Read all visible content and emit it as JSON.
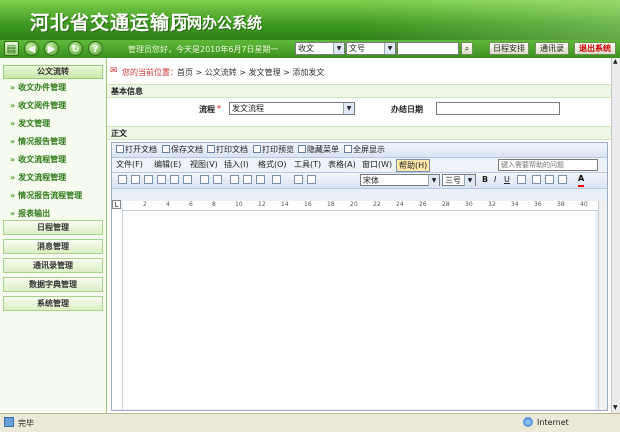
{
  "header": {
    "title": "河北省交通运输厅",
    "subtitle": "内网办公系统"
  },
  "toolbar": {
    "greeting": "管理员您好，今天是2010年6月7日星期一",
    "doc_type_select": "收文",
    "doc_num_select": "文号",
    "search_value": "",
    "btn_schedule": "日程安排",
    "btn_contacts": "通讯录",
    "btn_logout": "退出系统"
  },
  "sidebar": {
    "header": "公文流转",
    "items": [
      "收文办件管理",
      "收文阅件管理",
      "发文管理",
      "情况报告管理",
      "收文流程管理",
      "发文流程管理",
      "情况报告流程管理",
      "报表输出"
    ],
    "sections": [
      "日程管理",
      "消息管理",
      "通讯录管理",
      "数据字典管理",
      "系统管理"
    ]
  },
  "breadcrumb": {
    "prefix": "您的当前位置：",
    "path": "首页 > 公文流转 > 发文管理 > 添加发文"
  },
  "basic_info": {
    "title": "基本信息",
    "flow_label": "流程",
    "required_mark": "*",
    "flow_value": "发文流程",
    "date_label": "办结日期",
    "date_value": ""
  },
  "body_section": {
    "title": "正文"
  },
  "editor": {
    "actions": [
      "打开文档",
      "保存文档",
      "打印文档",
      "打印预览",
      "隐藏菜单",
      "全屏显示"
    ],
    "menus": [
      "文件(F)",
      "编辑(E)",
      "视图(V)",
      "插入(I)",
      "格式(O)",
      "工具(T)",
      "表格(A)",
      "窗口(W)",
      "帮助(H)"
    ],
    "help_placeholder": "键入需要帮助的问题",
    "font_name": "宋体",
    "font_size": "三号",
    "bold": "B",
    "italic": "I",
    "underline": "U",
    "font_color": "A",
    "ruler_marks": [
      "2",
      "4",
      "6",
      "8",
      "10",
      "12",
      "14",
      "16",
      "18",
      "20",
      "22",
      "24",
      "26",
      "28",
      "30",
      "32",
      "34",
      "36",
      "38",
      "40"
    ]
  },
  "statusbar": {
    "status": "完毕",
    "zone": "Internet"
  },
  "colors": {
    "header_green": "#3f9a22",
    "accent_green": "#2f7a19",
    "logout_red": "#cc0000"
  }
}
